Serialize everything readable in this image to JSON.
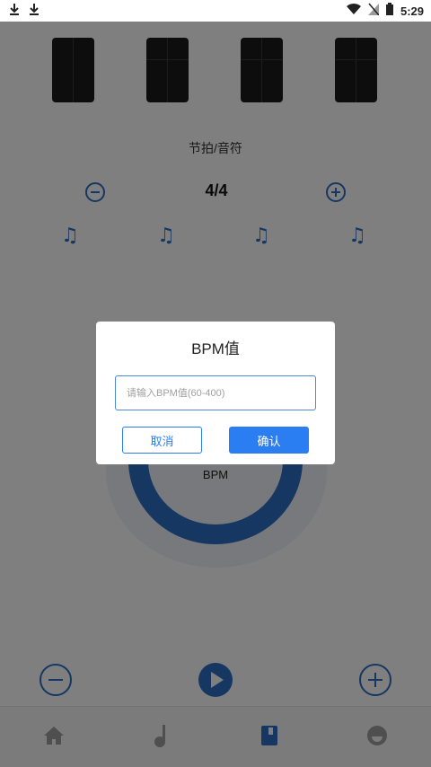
{
  "status_bar": {
    "time": "5:29",
    "left_icons": [
      "download-icon",
      "download-icon"
    ],
    "right_icons": [
      "wifi-icon",
      "signal-icon",
      "battery-icon"
    ]
  },
  "metronome": {
    "section_title": "节拍/音符",
    "time_signature": "4/4",
    "note_icons": [
      "music-note-icon",
      "music-note-icon",
      "music-note-icon",
      "music-note-icon"
    ],
    "bpm_label": "BPM"
  },
  "dialog": {
    "title": "BPM值",
    "input_placeholder": "请输入BPM值(60-400)",
    "input_value": "",
    "cancel_label": "取消",
    "confirm_label": "确认"
  },
  "tabs": [
    "home-icon",
    "music-note-icon",
    "book-icon",
    "face-icon"
  ],
  "colors": {
    "accent": "#2a6fc4",
    "button_primary": "#2a7ef2",
    "overlay": "rgba(0,0,0,0.5)"
  }
}
